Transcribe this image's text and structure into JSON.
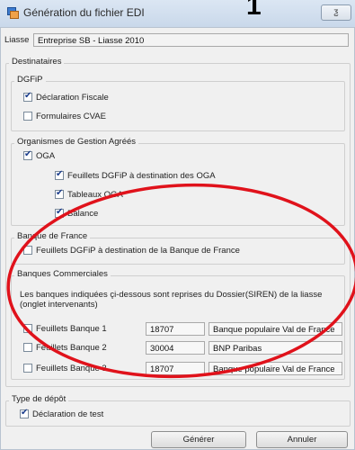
{
  "window": {
    "title": "Génération du fichier EDI",
    "overlay_number": "1",
    "close_glyph": "ƺ"
  },
  "liasse": {
    "label": "Liasse",
    "value": "Entreprise SB - Liasse 2010"
  },
  "destinataires": {
    "title": "Destinataires"
  },
  "dgfip": {
    "title": "DGFiP",
    "declaration_fiscale": {
      "label": "Déclaration Fiscale",
      "checked": true
    },
    "formulaires_cvae": {
      "label": "Formulaires CVAE",
      "checked": false
    }
  },
  "oga": {
    "title": "Organismes de Gestion Agréés",
    "oga": {
      "label": "OGA",
      "checked": true
    },
    "feuillets": {
      "label": "Feuillets DGFiP à destination des OGA",
      "checked": true
    },
    "tableaux": {
      "label": "Tableaux OGA",
      "checked": true
    },
    "balance": {
      "label": "Balance",
      "checked": true
    }
  },
  "banque_de_france": {
    "title": "Banque de France",
    "feuillets": {
      "label": "Feuillets DGFiP à destination de la Banque de France",
      "checked": false
    }
  },
  "banques_commerciales": {
    "title": "Banques Commerciales",
    "note": "Les banques indiquées çi-dessous sont reprises du Dossier(SIREN) de la liasse (onglet intervenants)",
    "rows": [
      {
        "label": "Feuillets Banque 1",
        "code": "18707",
        "name": "Banque populaire Val de France",
        "checked": false
      },
      {
        "label": "Feuillets Banque 2",
        "code": "30004",
        "name": "BNP Paribas",
        "checked": false
      },
      {
        "label": "Feuillets Banque 3",
        "code": "18707",
        "name": "Banque populaire Val de France",
        "checked": false
      }
    ]
  },
  "type_de_depot": {
    "title": "Type de dépôt",
    "declaration_de_test": {
      "label": "Déclaration de test",
      "checked": true
    }
  },
  "buttons": {
    "generate": "Générer",
    "cancel": "Annuler"
  },
  "annotation": {
    "color": "#e0121b"
  }
}
